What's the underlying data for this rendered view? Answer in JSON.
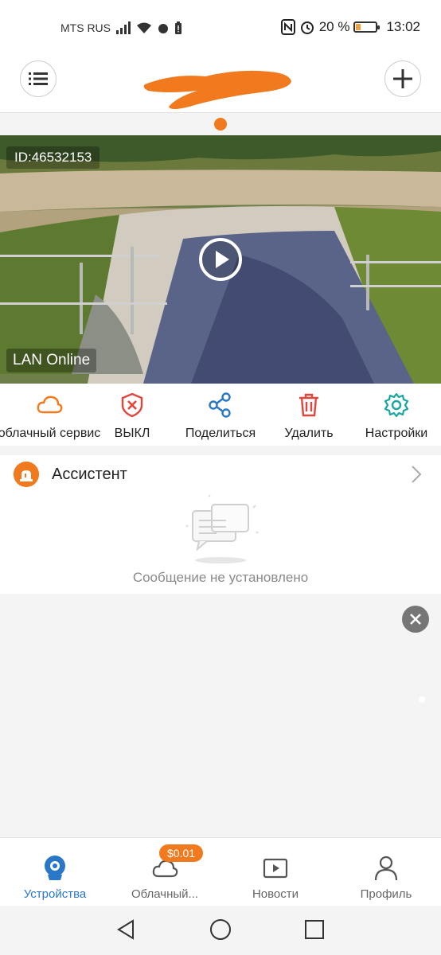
{
  "status_bar": {
    "carrier": "MTS RUS",
    "battery_text": "20 %",
    "time": "13:02"
  },
  "header": {
    "menu_icon": "list-icon",
    "add_icon": "plus-icon"
  },
  "camera": {
    "id_label": "ID:46532153",
    "connection_status": "LAN Online",
    "play_icon": "play-icon"
  },
  "actions": [
    {
      "label": "облачный сервис",
      "icon": "cloud-icon",
      "color": "#f07a1d"
    },
    {
      "label": "ВЫКЛ",
      "icon": "shield-x-icon",
      "color": "#e2453c"
    },
    {
      "label": "Поделиться",
      "icon": "share-icon",
      "color": "#2a77c8"
    },
    {
      "label": "Удалить",
      "icon": "trash-icon",
      "color": "#e2453c"
    },
    {
      "label": "Настройки",
      "icon": "gear-icon",
      "color": "#1aa6a0"
    }
  ],
  "assistant": {
    "title": "Ассистент",
    "empty_message": "Сообщение не установлено"
  },
  "bottom_nav": [
    {
      "label": "Устройства",
      "icon": "camera-icon",
      "active": true
    },
    {
      "label": "Облачный...",
      "icon": "cloud-icon",
      "badge": "$0.01"
    },
    {
      "label": "Новости",
      "icon": "video-icon"
    },
    {
      "label": "Профиль",
      "icon": "user-icon"
    }
  ],
  "colors": {
    "accent": "#f07a1d",
    "active_blue": "#2a77c8"
  }
}
